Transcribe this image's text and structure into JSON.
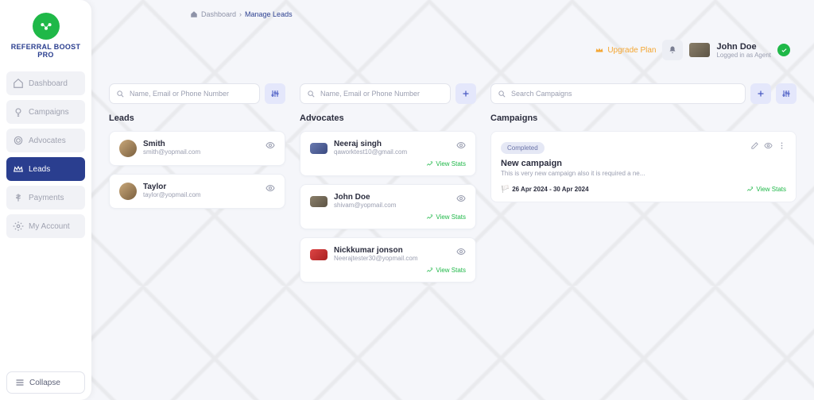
{
  "brand": {
    "line1": "REFERRAL",
    "line2": "BOOST PRO"
  },
  "sidebar": {
    "items": [
      {
        "label": "Dashboard"
      },
      {
        "label": "Campaigns"
      },
      {
        "label": "Advocates"
      },
      {
        "label": "Leads"
      },
      {
        "label": "Payments"
      },
      {
        "label": "My Account"
      }
    ],
    "collapse": "Collapse"
  },
  "breadcrumb": {
    "root": "Dashboard",
    "sep": "›",
    "current": "Manage Leads"
  },
  "header": {
    "upgrade": "Upgrade Plan",
    "username": "John Doe",
    "role": "Logged in as Agent"
  },
  "search": {
    "leads_ph": "Name, Email or Phone Number",
    "advocates_ph": "Name, Email or Phone Number",
    "campaigns_ph": "Search Campaigns"
  },
  "titles": {
    "leads": "Leads",
    "advocates": "Advocates",
    "campaigns": "Campaigns"
  },
  "leads": [
    {
      "name": "Smith",
      "sub": "smith@yopmail.com"
    },
    {
      "name": "Taylor",
      "sub": "taylor@yopmail.com"
    }
  ],
  "advocates": [
    {
      "name": "Neeraj singh",
      "sub": "qaworktest10@gmail.com"
    },
    {
      "name": "John Doe",
      "sub": "shivam@yopmail.com"
    },
    {
      "name": "Nickkumar jonson",
      "sub": "Neerajtester30@yopmail.com"
    }
  ],
  "view_stats_label": "View Stats",
  "campaign": {
    "status": "Completed",
    "title": "New campaign",
    "desc": "This is very new campaign also it is required a ne...",
    "dates": "26 Apr 2024 - 30 Apr 2024",
    "stats": "View Stats"
  }
}
